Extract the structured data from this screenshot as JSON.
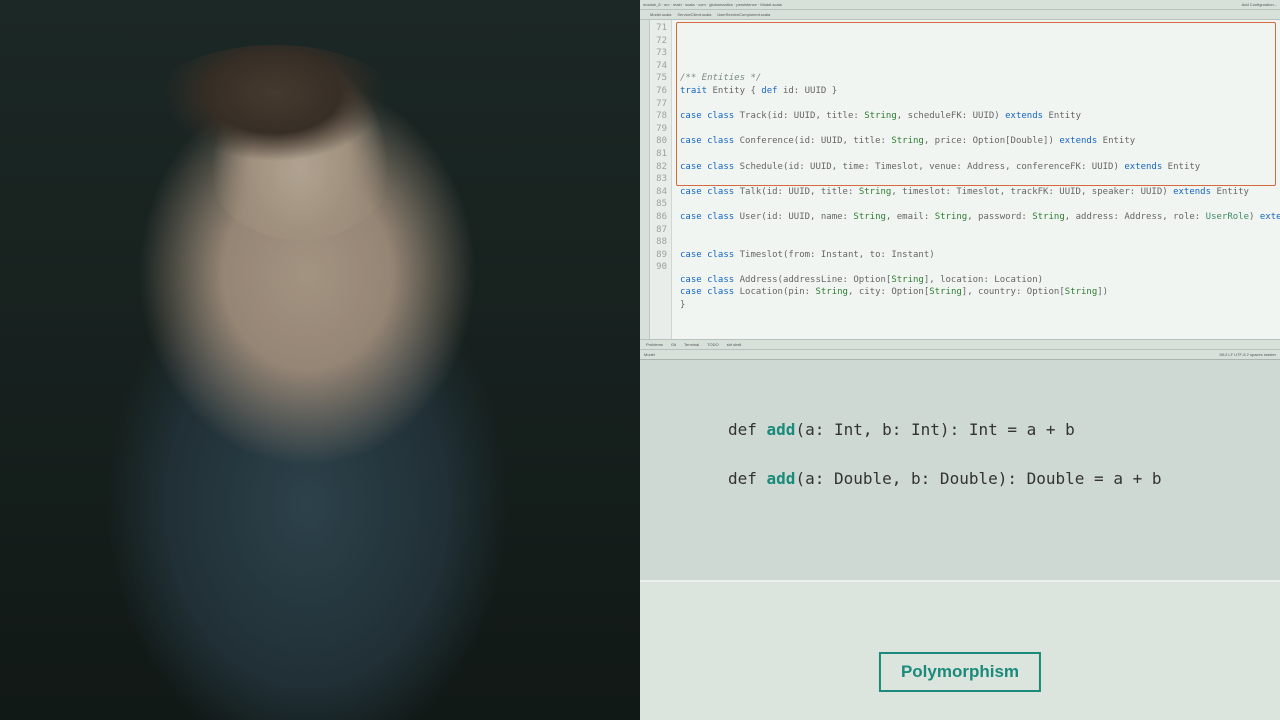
{
  "ide": {
    "breadcrumb": "module_8 · src · main · scala · com · globomantics · persistence · Model.scala",
    "tabs": [
      "Model.scala",
      "ServiceClient.scala",
      "UserServiceComponent.scala"
    ],
    "toolbar_config": "Add Configuration...",
    "line_start": 71,
    "lines": [
      {
        "n": 71,
        "t": ""
      },
      {
        "n": 72,
        "t": "/** Entities */",
        "cls": "cmt"
      },
      {
        "n": 73,
        "t": "trait Entity { def id: UUID }",
        "tokens": [
          [
            "kw",
            "trait"
          ],
          [
            "",
            " Entity { "
          ],
          [
            "kw",
            "def"
          ],
          [
            "",
            " id: UUID }"
          ]
        ]
      },
      {
        "n": 74,
        "t": ""
      },
      {
        "n": 75,
        "tokens": [
          [
            "kw",
            "case class"
          ],
          [
            "",
            " Track(id: UUID, title: "
          ],
          [
            "type",
            "String"
          ],
          [
            "",
            ", scheduleFK: UUID) "
          ],
          [
            "kw2",
            "extends"
          ],
          [
            "",
            " Entity"
          ]
        ]
      },
      {
        "n": 76,
        "t": ""
      },
      {
        "n": 77,
        "tokens": [
          [
            "kw",
            "case class"
          ],
          [
            "",
            " Conference(id: UUID, title: "
          ],
          [
            "type",
            "String"
          ],
          [
            "",
            ", price: Option[Double]) "
          ],
          [
            "kw2",
            "extends"
          ],
          [
            "",
            " Entity"
          ]
        ]
      },
      {
        "n": 78,
        "t": ""
      },
      {
        "n": 79,
        "tokens": [
          [
            "kw",
            "case class"
          ],
          [
            "",
            " Schedule(id: UUID, time: Timeslot, venue: Address, conferenceFK: UUID) "
          ],
          [
            "kw2",
            "extends"
          ],
          [
            "",
            " Entity"
          ]
        ]
      },
      {
        "n": 80,
        "t": ""
      },
      {
        "n": 81,
        "tokens": [
          [
            "kw",
            "case class"
          ],
          [
            "",
            " Talk(id: UUID, title: "
          ],
          [
            "type",
            "String"
          ],
          [
            "",
            ", timeslot: Timeslot, trackFK: UUID, speaker: UUID) "
          ],
          [
            "kw2",
            "extends"
          ],
          [
            "",
            " Entity"
          ]
        ]
      },
      {
        "n": 82,
        "t": ""
      },
      {
        "n": 83,
        "tokens": [
          [
            "kw",
            "case class"
          ],
          [
            "",
            " User(id: UUID, name: "
          ],
          [
            "type",
            "String"
          ],
          [
            "",
            ", email: "
          ],
          [
            "type",
            "String"
          ],
          [
            "",
            ", password: "
          ],
          [
            "type",
            "String"
          ],
          [
            "",
            ", address: Address, role: "
          ],
          [
            "typelink",
            "UserRole"
          ],
          [
            "",
            ") "
          ],
          [
            "kw2",
            "extends"
          ],
          [
            "",
            " Entity"
          ]
        ]
      },
      {
        "n": 84,
        "t": ""
      },
      {
        "n": 85,
        "t": ""
      },
      {
        "n": 86,
        "tokens": [
          [
            "kw",
            "case class"
          ],
          [
            "",
            " Timeslot(from: Instant, to: Instant)"
          ]
        ]
      },
      {
        "n": 87,
        "t": ""
      },
      {
        "n": 88,
        "tokens": [
          [
            "kw",
            "case class"
          ],
          [
            "",
            " Address(addressLine: Option["
          ],
          [
            "type",
            "String"
          ],
          [
            "",
            "], location: Location)"
          ]
        ]
      },
      {
        "n": 89,
        "tokens": [
          [
            "kw",
            "case class"
          ],
          [
            "",
            " Location(pin: "
          ],
          [
            "type",
            "String"
          ],
          [
            "",
            ", city: Option["
          ],
          [
            "type",
            "String"
          ],
          [
            "",
            "], country: Option["
          ],
          [
            "type",
            "String"
          ],
          [
            "",
            "])"
          ]
        ]
      },
      {
        "n": 90,
        "t": "}"
      }
    ],
    "tool_tabs": [
      "Problems",
      "Git",
      "Terminal",
      "TODO",
      "sbt shell"
    ],
    "status_left": "Model",
    "status_right": "89:2  LF  UTF-8  2 spaces  master"
  },
  "slide": {
    "line1_prefix": "def ",
    "line1_fn": "add",
    "line1_rest": "(a: Int, b: Int): Int = a + b",
    "line2_prefix": "def ",
    "line2_fn": "add",
    "line2_rest": "(a: Double, b: Double): Double = a + b",
    "badge": "Polymorphism"
  }
}
